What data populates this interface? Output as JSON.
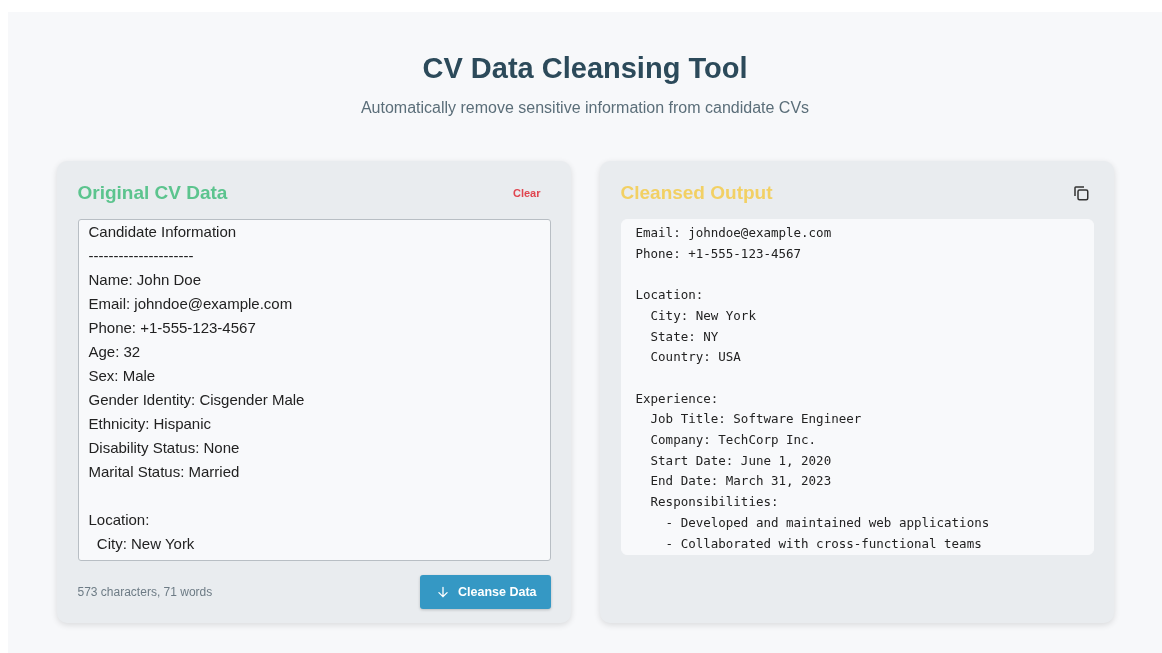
{
  "header": {
    "title": "CV Data Cleansing Tool",
    "subtitle": "Automatically remove sensitive information from candidate CVs"
  },
  "input_panel": {
    "title": "Original CV Data",
    "clear_button": "Clear",
    "lines": [
      {
        "text": "Candidate Information",
        "gap_before": false
      },
      {
        "text": "---------------------",
        "gap_before": false
      },
      {
        "text": "Name: John Doe",
        "gap_before": false
      },
      {
        "text": "Email: johndoe@example.com",
        "gap_before": false
      },
      {
        "text": "Phone: +1-555-123-4567",
        "gap_before": false
      },
      {
        "text": "Age: 32",
        "gap_before": false
      },
      {
        "text": "Sex: Male",
        "gap_before": false
      },
      {
        "text": "Gender Identity: Cisgender Male",
        "gap_before": false
      },
      {
        "text": "Ethnicity: Hispanic",
        "gap_before": false
      },
      {
        "text": "Disability Status: None",
        "gap_before": false
      },
      {
        "text": "Marital Status: Married",
        "gap_before": false
      },
      {
        "text": "Location:",
        "gap_before": true
      },
      {
        "text": "  City: New York",
        "gap_before": false
      }
    ],
    "stats": "573 characters, 71 words",
    "action_button": "Cleanse Data"
  },
  "output_panel": {
    "title": "Cleansed Output",
    "lines": [
      {
        "text": "Email: johndoe@example.com",
        "gap_before": false
      },
      {
        "text": "Phone: +1-555-123-4567",
        "gap_before": false
      },
      {
        "text": "Location:",
        "gap_before": true
      },
      {
        "text": "  City: New York",
        "gap_before": false
      },
      {
        "text": "  State: NY",
        "gap_before": false
      },
      {
        "text": "  Country: USA",
        "gap_before": false
      },
      {
        "text": "Experience:",
        "gap_before": true
      },
      {
        "text": "  Job Title: Software Engineer",
        "gap_before": false
      },
      {
        "text": "  Company: TechCorp Inc.",
        "gap_before": false
      },
      {
        "text": "  Start Date: June 1, 2020",
        "gap_before": false
      },
      {
        "text": "  End Date: March 31, 2023",
        "gap_before": false
      },
      {
        "text": "  Responsibilities:",
        "gap_before": false
      },
      {
        "text": "    - Developed and maintained web applications",
        "gap_before": false
      },
      {
        "text": "    - Collaborated with cross-functional teams",
        "gap_before": false
      }
    ]
  }
}
